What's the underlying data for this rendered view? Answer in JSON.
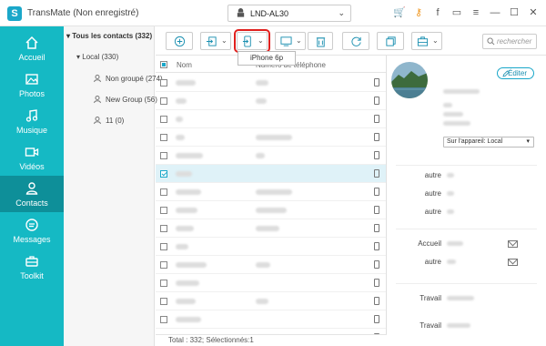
{
  "app": {
    "logo_letter": "S",
    "title": "TransMate (Non enregistré)"
  },
  "device": {
    "name": "LND-AL30"
  },
  "window_icons": [
    "cart-icon",
    "key-icon",
    "facebook-icon",
    "chat-icon",
    "menu-icon",
    "minimize-icon",
    "maximize-icon",
    "close-icon"
  ],
  "window_glyphs": [
    "🛒",
    "⚷",
    "f",
    "▭",
    "≡",
    "—",
    "☐",
    "✕"
  ],
  "sidebar": {
    "items": [
      {
        "label": "Accueil",
        "icon": "home-icon"
      },
      {
        "label": "Photos",
        "icon": "photo-icon"
      },
      {
        "label": "Musique",
        "icon": "music-icon"
      },
      {
        "label": "Vidéos",
        "icon": "video-icon"
      },
      {
        "label": "Contacts",
        "icon": "contacts-icon",
        "active": true
      },
      {
        "label": "Messages",
        "icon": "messages-icon"
      },
      {
        "label": "Toolkit",
        "icon": "toolkit-icon"
      }
    ]
  },
  "tree": {
    "root": "▾ Tous les contacts (332)",
    "local": "▾ Local (330)",
    "groups": [
      "Non groupé (274)",
      "New Group (56)",
      "11 (0)"
    ]
  },
  "toolbar": {
    "tooltip": "iPhone 6p",
    "search_placeholder": "rechercher"
  },
  "list": {
    "col_name": "Nom",
    "col_phone": "Numéro de téléphone",
    "rows": 15,
    "selected_row": 5
  },
  "footer": "Total : 332; Sélectionnés:1",
  "detail": {
    "edit_label": "Éditer",
    "device_select": "Sur l'appareil: Local",
    "fields": [
      {
        "label": "autre"
      },
      {
        "label": "autre"
      },
      {
        "label": "autre"
      },
      {
        "label": "Accueil",
        "mail": true
      },
      {
        "label": "autre",
        "mail": true
      },
      {
        "label": "Travail"
      },
      {
        "label": "Travail"
      }
    ]
  },
  "colors": {
    "accent": "#15b9c4",
    "active_nav": "#0e8f99",
    "highlight": "#e0201e"
  }
}
